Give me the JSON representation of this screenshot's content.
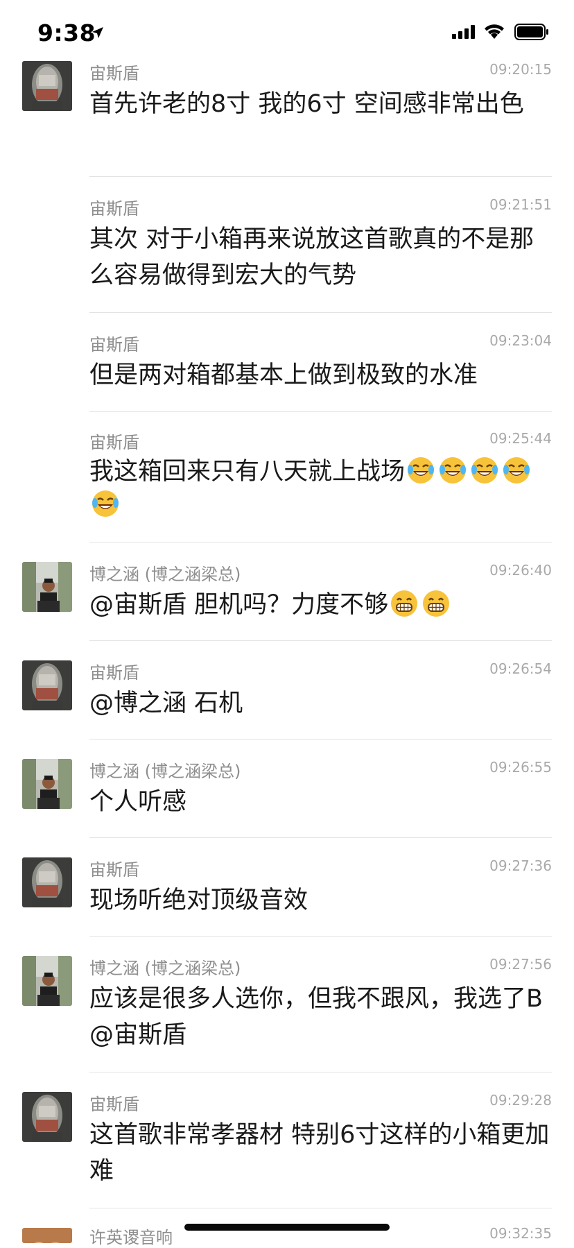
{
  "status_bar": {
    "time": "9:38"
  },
  "messages": [
    {
      "sender": "宙斯盾",
      "time": "09:20:15",
      "text": "首先许老的8寸  我的6寸  空间感非常出色",
      "avatar": "tube",
      "emojis": []
    },
    {
      "sender": "宙斯盾",
      "time": "09:21:51",
      "text": "其次  对于小箱再来说放这首歌真的不是那么容易做得到宏大的气势",
      "avatar": "",
      "emojis": []
    },
    {
      "sender": "宙斯盾",
      "time": "09:23:04",
      "text": "但是两对箱都基本上做到极致的水准",
      "avatar": "",
      "emojis": []
    },
    {
      "sender": "宙斯盾",
      "time": "09:25:44",
      "text": "我这箱回来只有八天就上战场",
      "avatar": "",
      "emojis": [
        "laugh-cry",
        "laugh-cry",
        "laugh-cry",
        "laugh-cry",
        "laugh-cry"
      ]
    },
    {
      "sender": "博之涵 (博之涵梁总)",
      "time": "09:26:40",
      "text": "@宙斯盾 胆机吗？力度不够",
      "avatar": "person",
      "emojis": [
        "grin",
        "grin"
      ]
    },
    {
      "sender": "宙斯盾",
      "time": "09:26:54",
      "text": "@博之涵 石机",
      "avatar": "tube",
      "emojis": []
    },
    {
      "sender": "博之涵 (博之涵梁总)",
      "time": "09:26:55",
      "text": "个人听感",
      "avatar": "person",
      "emojis": []
    },
    {
      "sender": "宙斯盾",
      "time": "09:27:36",
      "text": "现场听绝对顶级音效",
      "avatar": "tube",
      "emojis": []
    },
    {
      "sender": "博之涵 (博之涵梁总)",
      "time": "09:27:56",
      "text": "应该是很多人选你，但我不跟风，我选了B@宙斯盾",
      "avatar": "person",
      "emojis": []
    },
    {
      "sender": "宙斯盾",
      "time": "09:29:28",
      "text": "这首歌非常孝器材  特别6寸这样的小箱更加难",
      "avatar": "tube",
      "emojis": []
    },
    {
      "sender": "许英谡音响",
      "time": "09:32:35",
      "text": "",
      "avatar": "couple",
      "emojis": []
    }
  ]
}
